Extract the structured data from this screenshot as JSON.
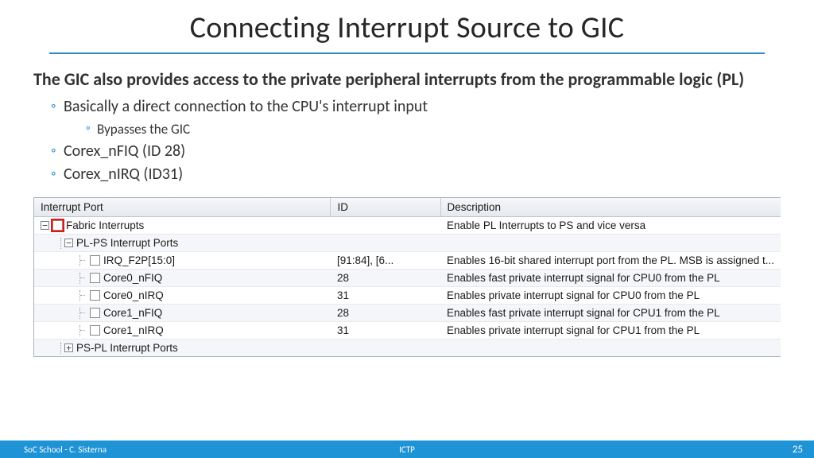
{
  "title": "Connecting Interrupt Source to GIC",
  "lead": "The GIC also provides access to the private peripheral interrupts from the programmable logic (PL)",
  "bullets": {
    "a": "Basically a direct connection to the CPU's interrupt input",
    "a1": "Bypasses the GIC",
    "b": "Corex_nFIQ (ID 28)",
    "c": "Corex_nIRQ (ID31)"
  },
  "table": {
    "headers": {
      "port": "Interrupt Port",
      "id": "ID",
      "desc": "Description"
    },
    "rows": [
      {
        "port": "Fabric Interrupts",
        "id": "",
        "desc": "Enable PL Interrupts to PS and vice versa"
      },
      {
        "port": "PL-PS Interrupt Ports",
        "id": "",
        "desc": ""
      },
      {
        "port": "IRQ_F2P[15:0]",
        "id": "[91:84], [6...",
        "desc": "Enables 16-bit shared interrupt port from the PL. MSB is assigned t..."
      },
      {
        "port": "Core0_nFIQ",
        "id": "28",
        "desc": "Enables fast private interrupt signal for CPU0 from the PL"
      },
      {
        "port": "Core0_nIRQ",
        "id": "31",
        "desc": "Enables private interrupt signal for CPU0 from the PL"
      },
      {
        "port": "Core1_nFIQ",
        "id": "28",
        "desc": "Enables fast private interrupt signal for CPU1 from the PL"
      },
      {
        "port": "Core1_nIRQ",
        "id": "31",
        "desc": "Enables private interrupt signal for CPU1 from the PL"
      },
      {
        "port": "PS-PL Interrupt Ports",
        "id": "",
        "desc": ""
      }
    ]
  },
  "footer": {
    "left": "SoC School - C. Sisterna",
    "center": "ICTP",
    "right": "25"
  }
}
